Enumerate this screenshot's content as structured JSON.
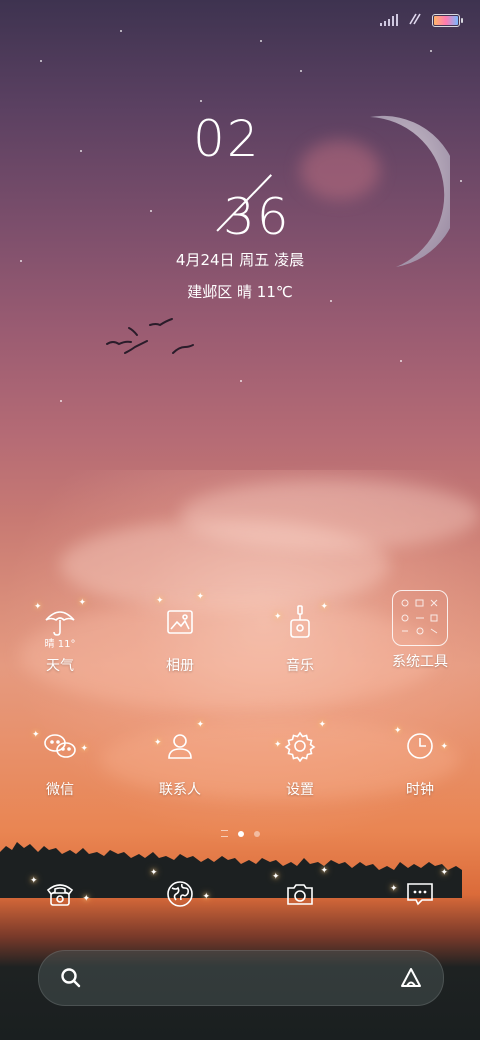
{
  "status_bar": {
    "signal_icon": "signal-bars-icon",
    "wifi_icon": "data-icon",
    "battery_icon": "battery-icon"
  },
  "clock": {
    "hours": "02",
    "minutes": "36"
  },
  "date_line": "4月24日 周五 凌晨",
  "weather_line": "建邺区 晴 11℃",
  "apps_row1": [
    {
      "label": "天气",
      "icon": "umbrella-weather-icon",
      "badge": "晴 11°"
    },
    {
      "label": "相册",
      "icon": "photo-album-icon"
    },
    {
      "label": "音乐",
      "icon": "music-guitar-icon"
    },
    {
      "label": "系统工具",
      "icon": "folder-system-tools-icon"
    }
  ],
  "apps_row2": [
    {
      "label": "微信",
      "icon": "wechat-icon"
    },
    {
      "label": "联系人",
      "icon": "contacts-icon"
    },
    {
      "label": "设置",
      "icon": "settings-gear-icon"
    },
    {
      "label": "时钟",
      "icon": "clock-icon"
    }
  ],
  "page_indicator": {
    "pages": 3,
    "current": 2
  },
  "dock": [
    {
      "icon": "phone-icon"
    },
    {
      "icon": "browser-globe-icon"
    },
    {
      "icon": "camera-icon"
    },
    {
      "icon": "messages-icon"
    }
  ],
  "search": {
    "placeholder": "",
    "left_icon": "search-icon",
    "right_icon": "assistant-icon"
  },
  "colors": {
    "accent_white": "#ffffff",
    "sparkle": "#ffd38a"
  }
}
